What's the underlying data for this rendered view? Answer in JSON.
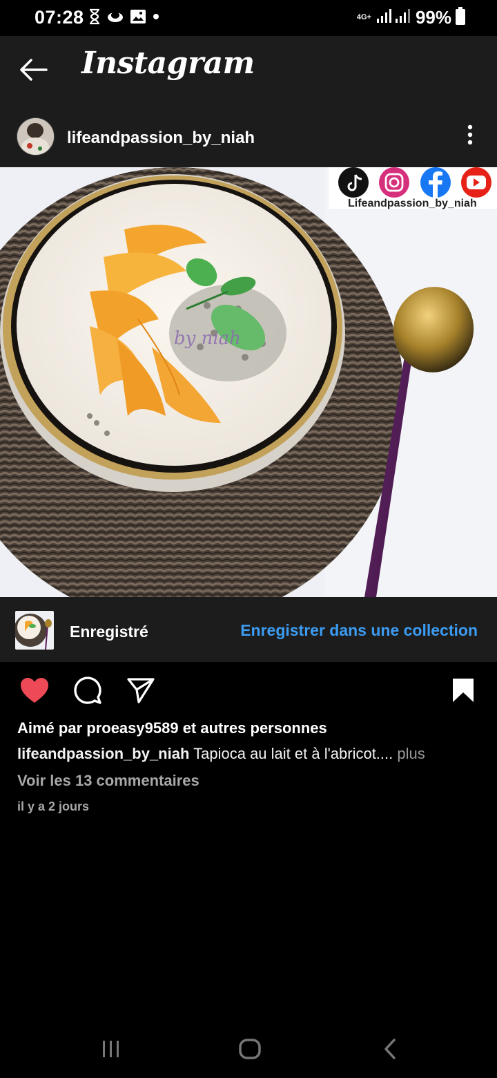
{
  "status": {
    "time": "07:28",
    "network": "4G+",
    "battery": "99%"
  },
  "header": {
    "title": "Instagram"
  },
  "post": {
    "username": "lifeandpassion_by_niah",
    "image_watermark": "by niah",
    "image_banner_handle": "Lifeandpassion_by_niah"
  },
  "saved_bar": {
    "label": "Enregistré",
    "link": "Enregistrer dans une collection"
  },
  "engagement": {
    "liked": true,
    "saved": true,
    "likes_text": "Aimé par proeasy9589 et autres personnes",
    "caption_user": "lifeandpassion_by_niah",
    "caption_text": " Tapioca au lait et à l'abricot.... ",
    "caption_more": "plus",
    "comments": "Voir les 13 commentaires",
    "timestamp": "il y a 2 jours"
  },
  "colors": {
    "accent": "#3c9cf2",
    "like": "#ed4956",
    "surface": "#1c1c1c",
    "background": "#000000"
  },
  "icons": [
    "hourglass-icon",
    "cloud-icon",
    "gallery-icon",
    "signal-icon",
    "battery-icon",
    "back-arrow-icon",
    "more-vertical-icon",
    "heart-icon",
    "comment-icon",
    "share-icon",
    "bookmark-icon",
    "recent-apps-icon",
    "home-icon",
    "back-icon",
    "tiktok-icon",
    "instagram-icon",
    "facebook-icon",
    "youtube-icon"
  ]
}
